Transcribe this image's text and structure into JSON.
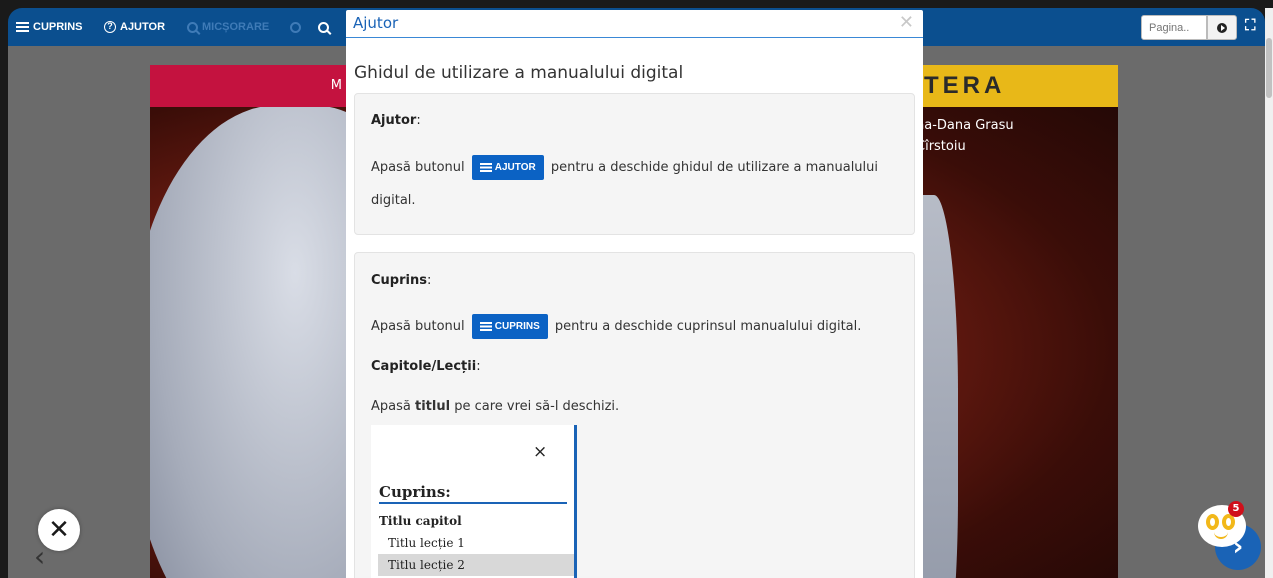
{
  "toolbar": {
    "cuprins": "CUPRINS",
    "ajutor_icon": "?",
    "ajutor": "AJUTOR",
    "micsorare": "MICȘORARE",
    "page_placeholder": "Pagina..",
    "fullscreen_glyph": "⛶",
    "icons": [
      "hamburger-icon",
      "help-circle-icon",
      "zoom-out-icon",
      "reset-icon",
      "zoom-in-icon",
      "go-icon",
      "fullscreen-icon"
    ]
  },
  "book": {
    "left_band_fragment": "M",
    "right_band_fragment": "TERA",
    "author_1": "na-Dana Grasu",
    "author_2": "Cîrstoiu"
  },
  "modal": {
    "title": "Ajutor",
    "close_glyph": "✕",
    "guide_title": "Ghidul de utilizare a manualului digital",
    "ajutor_section": {
      "heading": "Ajutor",
      "colon": ":",
      "text_before": "Apasă butonul",
      "button_label": "AJUTOR",
      "text_after": "pentru a deschide ghidul de utilizare a manualului",
      "text_line2": "digital."
    },
    "cuprins_section": {
      "heading": "Cuprins",
      "colon": ":",
      "text_before": "Apasă butonul",
      "button_label": "CUPRINS",
      "text_after": "pentru a deschide cuprinsul manualului digital.",
      "sub_heading": "Capitole/Lecții",
      "sub_colon": ":",
      "sub_before": "Apasă",
      "sub_bold": "titlul",
      "sub_after": "pe care vrei să-l deschizi.",
      "toc_close": "×",
      "toc_title": "Cuprins:",
      "toc_chapter": "Titlu capitol",
      "toc_lessons": [
        "Titlu lecție 1",
        "Titlu lecție 2"
      ]
    }
  },
  "floating": {
    "close_glyph": "✕",
    "prev_glyph": "‹",
    "next_glyph": "›",
    "notification_count": "5"
  },
  "colors": {
    "toolbar_blue": "#0b4f8f",
    "accent_blue": "#1a63b6",
    "button_blue": "#0b62c4",
    "red_band": "#c4123f",
    "yellow_band": "#e8b818",
    "badge_red": "#d0101b"
  }
}
